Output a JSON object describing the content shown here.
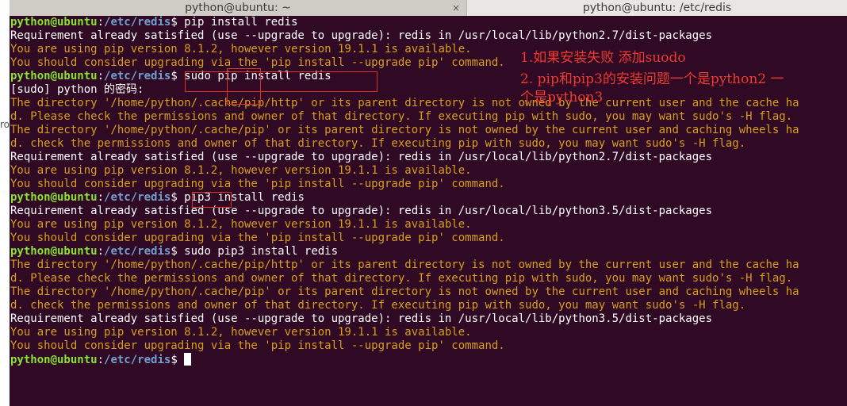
{
  "side_label": "ro",
  "tabs": {
    "left": {
      "title": "python@ubuntu: ~",
      "close": "×"
    },
    "right": {
      "title": "python@ubuntu: /etc/redis"
    }
  },
  "lines": [
    {
      "type": "prompt",
      "user": "python@ubuntu",
      "sep": ":",
      "path": "/etc/redis",
      "sym": "$ ",
      "cmd": "pip install redis"
    },
    {
      "type": "plain",
      "text": "Requirement already satisfied (use --upgrade to upgrade): redis in /usr/local/lib/python2.7/dist-packages"
    },
    {
      "type": "warn",
      "text": "You are using pip version 8.1.2, however version 19.1.1 is available."
    },
    {
      "type": "warn",
      "text": "You should consider upgrading via the 'pip install --upgrade pip' command."
    },
    {
      "type": "prompt",
      "user": "python@ubuntu",
      "sep": ":",
      "path": "/etc/redis",
      "sym": "$ ",
      "cmd": "sudo pip install redis"
    },
    {
      "type": "plain",
      "text": "[sudo] python 的密码:"
    },
    {
      "type": "warn",
      "text": "The directory '/home/python/.cache/pip/http' or its parent directory is not owned by the current user and the cache ha"
    },
    {
      "type": "warn",
      "text": "d. Please check the permissions and owner of that directory. If executing pip with sudo, you may want sudo's -H flag."
    },
    {
      "type": "warn",
      "text": "The directory '/home/python/.cache/pip' or its parent directory is not owned by the current user and caching wheels ha"
    },
    {
      "type": "warn",
      "text": "d. check the permissions and owner of that directory. If executing pip with sudo, you may want sudo's -H flag."
    },
    {
      "type": "plain",
      "text": "Requirement already satisfied (use --upgrade to upgrade): redis in /usr/local/lib/python2.7/dist-packages"
    },
    {
      "type": "warn",
      "text": "You are using pip version 8.1.2, however version 19.1.1 is available."
    },
    {
      "type": "warn",
      "text": "You should consider upgrading via the 'pip install --upgrade pip' command."
    },
    {
      "type": "prompt",
      "user": "python@ubuntu",
      "sep": ":",
      "path": "/etc/redis",
      "sym": "$ ",
      "cmd": "pip3 install redis"
    },
    {
      "type": "plain",
      "text": "Requirement already satisfied (use --upgrade to upgrade): redis in /usr/local/lib/python3.5/dist-packages"
    },
    {
      "type": "warn",
      "text": "You are using pip version 8.1.2, however version 19.1.1 is available."
    },
    {
      "type": "warn",
      "text": "You should consider upgrading via the 'pip install --upgrade pip' command."
    },
    {
      "type": "prompt",
      "user": "python@ubuntu",
      "sep": ":",
      "path": "/etc/redis",
      "sym": "$ ",
      "cmd": "sudo pip3 install redis"
    },
    {
      "type": "warn",
      "text": "The directory '/home/python/.cache/pip/http' or its parent directory is not owned by the current user and the cache ha"
    },
    {
      "type": "warn",
      "text": "d. Please check the permissions and owner of that directory. If executing pip with sudo, you may want sudo's -H flag."
    },
    {
      "type": "warn",
      "text": "The directory '/home/python/.cache/pip' or its parent directory is not owned by the current user and caching wheels ha"
    },
    {
      "type": "warn",
      "text": "d. check the permissions and owner of that directory. If executing pip with sudo, you may want sudo's -H flag."
    },
    {
      "type": "plain",
      "text": "Requirement already satisfied (use --upgrade to upgrade): redis in /usr/local/lib/python3.5/dist-packages"
    },
    {
      "type": "warn",
      "text": "You are using pip version 8.1.2, however version 19.1.1 is available."
    },
    {
      "type": "warn",
      "text": "You should consider upgrading via the 'pip install --upgrade pip' command."
    },
    {
      "type": "prompt",
      "user": "python@ubuntu",
      "sep": ":",
      "path": "/etc/redis",
      "sym": "$ ",
      "cmd": "",
      "cursor": true
    }
  ],
  "annotations": {
    "note1": "1.如果安装失败 添加suodo",
    "note2": "2. pip和pip3的安装问题一个是python2 一",
    "note3": "个是python3"
  },
  "colors": {
    "background": "#300a24",
    "prompt_user": "#8ae234",
    "prompt_path": "#729fcf",
    "warning": "#d79f1b",
    "annotation": "#ee3b32"
  }
}
